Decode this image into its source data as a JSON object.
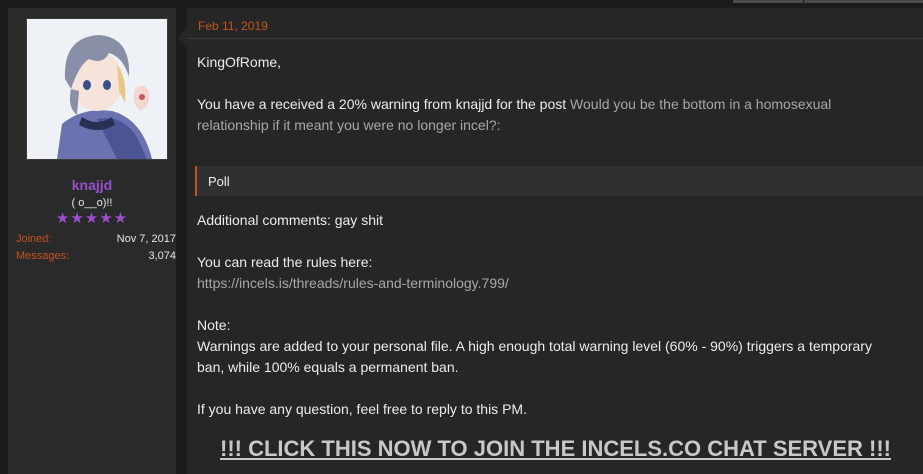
{
  "post": {
    "date": "Feb 11, 2019",
    "greeting": "KingOfRome,",
    "warning_text": "You have a received a 20% warning from knajjd for the post ",
    "warning_post_title": "Would you be the bottom in a homosexual relationship if it meant you were no longer incel?:",
    "poll_label": "Poll",
    "additional_comments": "Additional comments: gay shit",
    "rules_intro": "You can read the rules here:",
    "rules_link": "https://incels.is/threads/rules-and-terminology.799/",
    "note_heading": "Note:",
    "note_body": "Warnings are added to your personal file. A high enough total warning level (60% - 90%) triggers a temporary ban, while 100% equals a permanent ban.",
    "question_text": "If you have any question, feel free to reply to this PM.",
    "cta_link": "!!! CLICK THIS NOW TO JOIN THE INCELS.CO CHAT SERVER !!!"
  },
  "author": {
    "username": "knajjd",
    "title": "( o__o)!!",
    "stars": "★★★★★",
    "joined_label": "Joined:",
    "joined_value": "Nov 7, 2017",
    "messages_label": "Messages:",
    "messages_value": "3,074"
  },
  "colors": {
    "accent": "#c4541e",
    "username": "#9b4fd0",
    "link": "#a8a8a8",
    "background": "#1b1b1b"
  }
}
